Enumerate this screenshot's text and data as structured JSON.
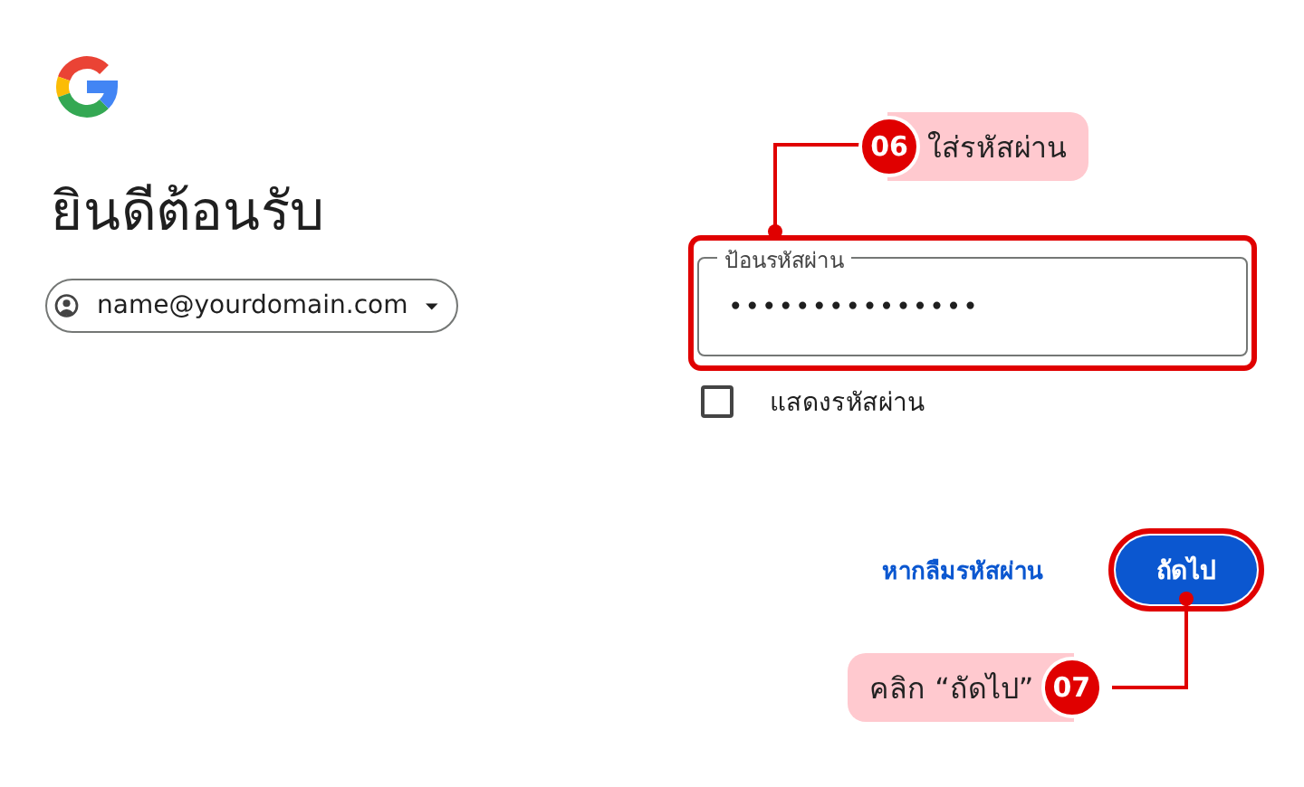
{
  "heading": "ยินดีต้อนรับ",
  "account": {
    "email": "name@yourdomain.com"
  },
  "password_field": {
    "label": "ป้อนรหัสผ่าน",
    "value": "•••••••••••••••",
    "highlighted": true
  },
  "show_password": {
    "label": "แสดงรหัสผ่าน",
    "checked": false
  },
  "forgot_link": "หากลืมรหัสผ่าน",
  "next_button": {
    "label": "ถัดไป",
    "highlighted": true
  },
  "annotations": [
    {
      "kind": "field",
      "number": "06",
      "text": "ใส่รหัสผ่าน"
    },
    {
      "kind": "button",
      "number": "07",
      "text": "คลิก “ถัดไป”"
    }
  ]
}
